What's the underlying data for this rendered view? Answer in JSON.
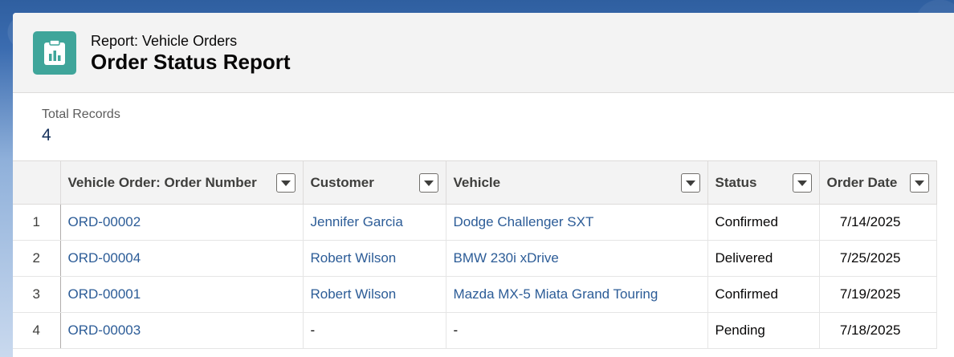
{
  "header": {
    "subtitle": "Report: Vehicle Orders",
    "title": "Order Status Report",
    "icon": "report-chart-icon",
    "icon_color": "#3fa59a"
  },
  "summary": {
    "label": "Total Records",
    "value": "4"
  },
  "table": {
    "columns": [
      "Vehicle Order: Order Number",
      "Customer",
      "Vehicle",
      "Status",
      "Order Date"
    ],
    "rows": [
      {
        "num": "1",
        "order": "ORD-00002",
        "customer": "Jennifer Garcia",
        "vehicle": "Dodge Challenger SXT",
        "status": "Confirmed",
        "date": "7/14/2025"
      },
      {
        "num": "2",
        "order": "ORD-00004",
        "customer": "Robert Wilson",
        "vehicle": "BMW 230i xDrive",
        "status": "Delivered",
        "date": "7/25/2025"
      },
      {
        "num": "3",
        "order": "ORD-00001",
        "customer": "Robert Wilson",
        "vehicle": "Mazda MX-5 Miata Grand Touring",
        "status": "Confirmed",
        "date": "7/19/2025"
      },
      {
        "num": "4",
        "order": "ORD-00003",
        "customer": "-",
        "vehicle": "-",
        "status": "Pending",
        "date": "7/18/2025"
      }
    ]
  }
}
